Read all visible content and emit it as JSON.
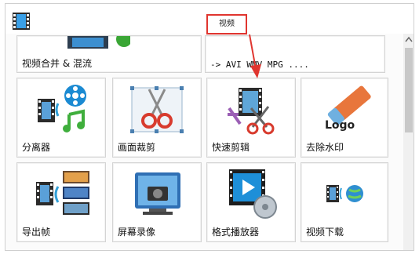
{
  "header": {
    "view_label": "视频"
  },
  "row1": [
    {
      "label": "视频合并 & 混流"
    },
    {
      "label": "-> AVI WMV MPG ...."
    }
  ],
  "tools": [
    {
      "label": "分离器",
      "icon": "film-reel-music-icon"
    },
    {
      "label": "画面裁剪",
      "icon": "scissors-crop-icon"
    },
    {
      "label": "快速剪辑",
      "icon": "film-scissors-icon"
    },
    {
      "label": "去除水印",
      "icon": "eraser-logo-icon",
      "icon_text": "Logo"
    },
    {
      "label": "导出帧",
      "icon": "film-frames-icon"
    },
    {
      "label": "屏幕录像",
      "icon": "screen-camera-icon"
    },
    {
      "label": "格式播放器",
      "icon": "play-reel-icon"
    },
    {
      "label": "视频下载",
      "icon": "film-globe-icon"
    }
  ],
  "colors": {
    "highlight": "#e0352f",
    "accent_blue": "#1a8fd6"
  }
}
